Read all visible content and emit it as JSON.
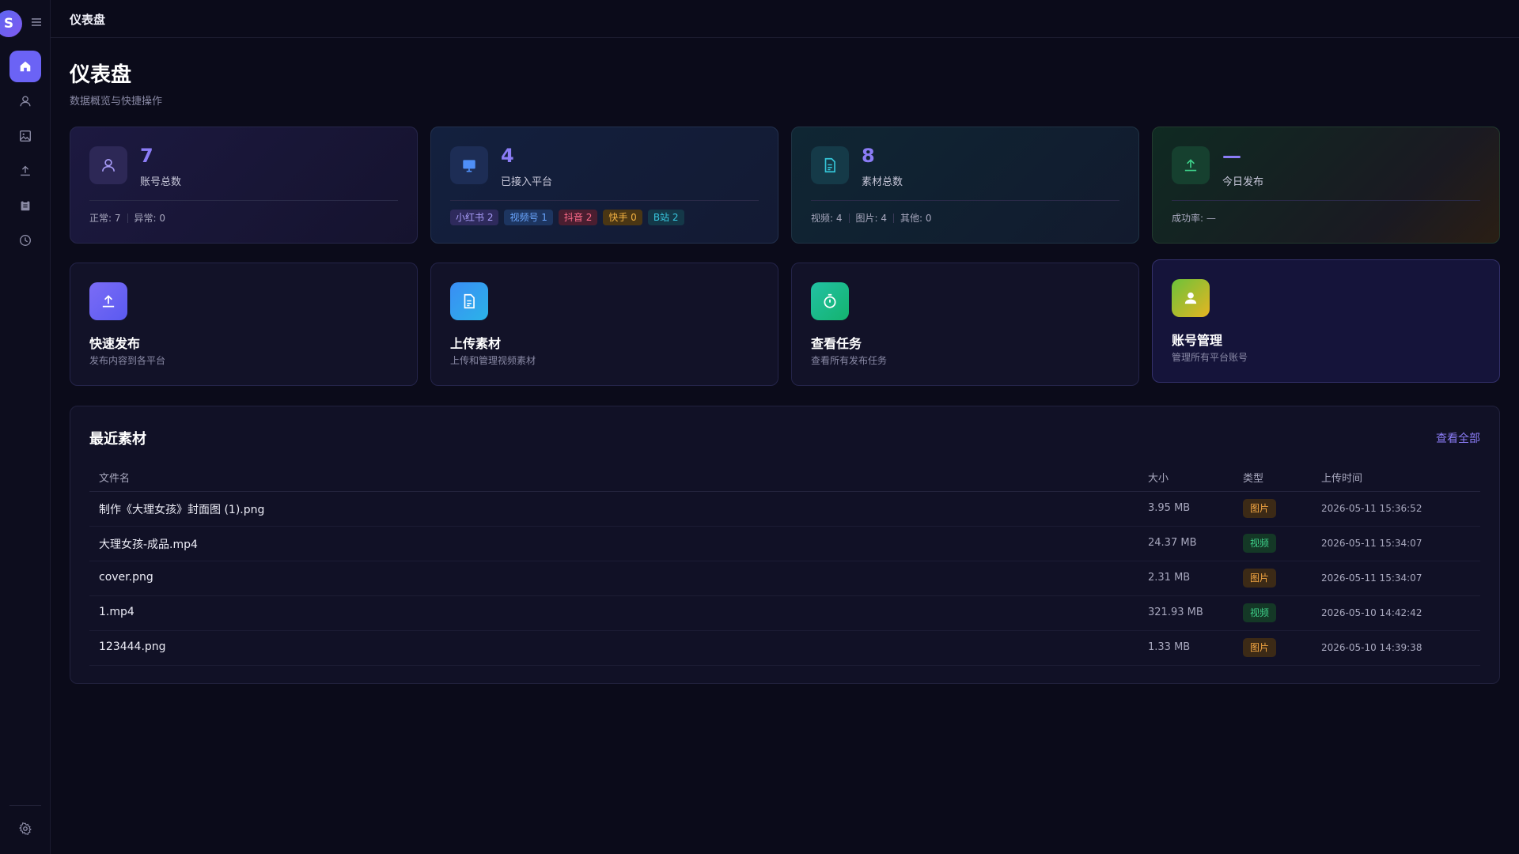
{
  "sidebar": {
    "logo_letter": "S",
    "items": [
      {
        "icon": "home-icon",
        "active": true
      },
      {
        "icon": "user-icon"
      },
      {
        "icon": "image-icon"
      },
      {
        "icon": "upload-icon"
      },
      {
        "icon": "clipboard-icon"
      },
      {
        "icon": "clock-icon"
      }
    ],
    "bottom_icon": "gear-icon"
  },
  "topbar": {
    "title": "仪表盘"
  },
  "header": {
    "title": "仪表盘",
    "subtitle": "数据概览与快捷操作"
  },
  "stats": {
    "accounts": {
      "value": "7",
      "label": "账号总数",
      "normal": "正常: 7",
      "abnormal": "异常: 0"
    },
    "platforms": {
      "value": "4",
      "label": "已接入平台",
      "tags": [
        "小红书 2",
        "视频号 1",
        "抖音 2",
        "快手 0",
        "B站 2"
      ]
    },
    "materials": {
      "value": "8",
      "label": "素材总数",
      "video": "视频: 4",
      "image": "图片: 4",
      "other": "其他: 0"
    },
    "today": {
      "value": "—",
      "label": "今日发布",
      "rate": "成功率: —"
    }
  },
  "actions": [
    {
      "title": "快速发布",
      "desc": "发布内容到各平台"
    },
    {
      "title": "上传素材",
      "desc": "上传和管理视频素材"
    },
    {
      "title": "查看任务",
      "desc": "查看所有发布任务"
    },
    {
      "title": "账号管理",
      "desc": "管理所有平台账号"
    }
  ],
  "recent": {
    "title": "最近素材",
    "view_all": "查看全部",
    "columns": [
      "文件名",
      "大小",
      "类型",
      "上传时间"
    ],
    "rows": [
      {
        "name": "制作《大理女孩》封面图 (1).png",
        "size": "3.95 MB",
        "type": "图片",
        "kind": "img",
        "time": "2026-05-11 15:36:52"
      },
      {
        "name": "大理女孩-成品.mp4",
        "size": "24.37 MB",
        "type": "视频",
        "kind": "vid",
        "time": "2026-05-11 15:34:07"
      },
      {
        "name": "cover.png",
        "size": "2.31 MB",
        "type": "图片",
        "kind": "img",
        "time": "2026-05-11 15:34:07"
      },
      {
        "name": "1.mp4",
        "size": "321.93 MB",
        "type": "视频",
        "kind": "vid",
        "time": "2026-05-10 14:42:42"
      },
      {
        "name": "123444.png",
        "size": "1.33 MB",
        "type": "图片",
        "kind": "img",
        "time": "2026-05-10 14:39:38"
      }
    ]
  },
  "colors": {
    "accent": "#8b7cf6",
    "active_nav": "#6b63f5",
    "background": "#0b0b1a"
  }
}
